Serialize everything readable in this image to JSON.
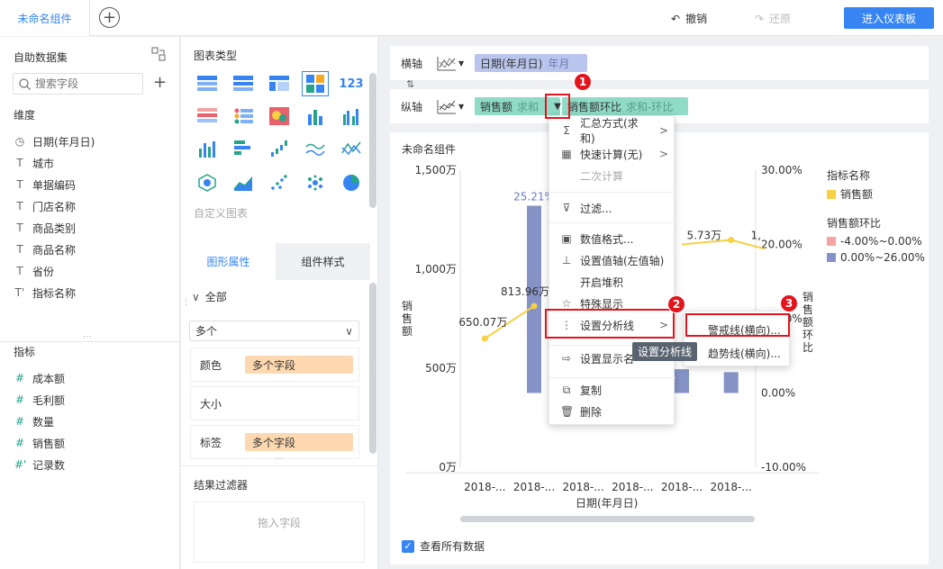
{
  "tabs": {
    "active": "未命名组件",
    "add": "+"
  },
  "toolbar": {
    "undo": "撤销",
    "redo": "还原",
    "enter_dashboard": "进入仪表板",
    "undo_icon": "undo-icon",
    "redo_icon": "redo-icon"
  },
  "dataset": {
    "title": "自助数据集",
    "search_placeholder": "搜索字段",
    "dim_title": "维度",
    "dimensions": [
      {
        "icon": "clock-icon",
        "label": "日期(年月日)"
      },
      {
        "icon": "text-icon",
        "label": "城市"
      },
      {
        "icon": "text-icon",
        "label": "单据编码"
      },
      {
        "icon": "text-icon",
        "label": "门店名称"
      },
      {
        "icon": "text-icon",
        "label": "商品类别"
      },
      {
        "icon": "text-icon",
        "label": "商品名称"
      },
      {
        "icon": "text-icon",
        "label": "省份"
      },
      {
        "icon": "text-calc-icon",
        "label": "指标名称"
      }
    ],
    "measure_title": "指标",
    "measures": [
      {
        "icon": "hash-icon",
        "label": "成本额"
      },
      {
        "icon": "hash-icon",
        "label": "毛利额"
      },
      {
        "icon": "hash-icon",
        "label": "数量"
      },
      {
        "icon": "hash-icon",
        "label": "销售额"
      },
      {
        "icon": "hash-calc-icon",
        "label": "记录数"
      }
    ]
  },
  "chart_types": {
    "title": "图表类型",
    "custom": "自定义图表",
    "num_label": "123"
  },
  "properties": {
    "tab_graph": "图形属性",
    "tab_style": "组件样式",
    "all": "全部",
    "select_value": "多个",
    "color_label": "颜色",
    "color_chip": "多个字段",
    "size_label": "大小",
    "label_label": "标签",
    "label_chip": "多个字段"
  },
  "result_filter": {
    "title": "结果过滤器",
    "drop_hint": "拖入字段"
  },
  "axes": {
    "x_label": "横轴",
    "x_field": "日期(年月日)",
    "x_field_sub": "年月",
    "y_label": "纵轴",
    "y_field": "销售额",
    "y_field_sub": "求和",
    "y_field2": "销售额环比",
    "y_field2_sub": "求和-环比",
    "swap": "⇅"
  },
  "chart": {
    "card_title": "未命名组件",
    "left_axis_label": "销售额",
    "right_axis_label": "销售额环比",
    "x_axis_label": "日期(年月日)",
    "left_ticks": [
      "1,500万",
      "1,000万",
      "500万",
      "0万"
    ],
    "right_ticks": [
      "30.00%",
      "20.00%",
      "10.00%",
      "0.00%",
      "-10.00%"
    ],
    "x_ticks": [
      "2018-...",
      "2018-...",
      "2018-...",
      "2018-...",
      "2018-...",
      "2018-..."
    ],
    "data_labels": [
      "650.07万",
      "813.96万",
      "25.21%",
      "5.73万",
      "1,"
    ],
    "legend": {
      "title1": "指标名称",
      "item1": "销售额",
      "title2": "销售额环比",
      "item2": "-4.00%~0.00%",
      "item3": "0.00%~26.00%"
    },
    "colors": {
      "bar": "#8592c6",
      "line": "#f7d043",
      "neg": "#f4a4a4"
    },
    "show_all": "查看所有数据"
  },
  "chart_data": {
    "type": "bar",
    "categories": [
      "2018-...",
      "2018-...",
      "2018-...",
      "2018-...",
      "2018-...",
      "2018-..."
    ],
    "series": [
      {
        "name": "销售额",
        "type": "line",
        "values": [
          650.07,
          813.96,
          null,
          null,
          null,
          null
        ]
      },
      {
        "name": "销售额环比",
        "type": "bar",
        "values": [
          null,
          25.21,
          null,
          null,
          null,
          null
        ]
      }
    ],
    "xlabel": "日期(年月日)",
    "ylabel": "销售额",
    "y2label": "销售额环比"
  },
  "menu": {
    "items": [
      {
        "icon": "sigma-icon",
        "label": "汇总方式(求和)",
        "arrow": ">"
      },
      {
        "icon": "calc-icon",
        "label": "快速计算(无)",
        "arrow": ">"
      },
      {
        "icon": "",
        "label": "二次计算",
        "arrow": ""
      },
      {
        "icon": "filter-icon",
        "label": "过滤...",
        "arrow": ""
      },
      {
        "icon": "number-format-icon",
        "label": "数值格式...",
        "arrow": ""
      },
      {
        "icon": "axis-icon",
        "label": "设置值轴(左值轴)",
        "arrow": ""
      },
      {
        "icon": "",
        "label": "开启堆积",
        "arrow": ""
      },
      {
        "icon": "star-icon",
        "label": "特殊显示",
        "arrow": ""
      },
      {
        "icon": "analysis-line-icon",
        "label": "设置分析线",
        "arrow": ">"
      },
      {
        "icon": "display-name-icon",
        "label": "设置显示名",
        "arrow": ""
      },
      {
        "icon": "copy-icon",
        "label": "复制",
        "arrow": ""
      },
      {
        "icon": "delete-icon",
        "label": "删除",
        "arrow": ""
      }
    ],
    "tooltip": "设置分析线",
    "submenu": [
      "警戒线(横向)...",
      "趋势线(横向)..."
    ],
    "badges": [
      "1",
      "2",
      "3"
    ]
  }
}
